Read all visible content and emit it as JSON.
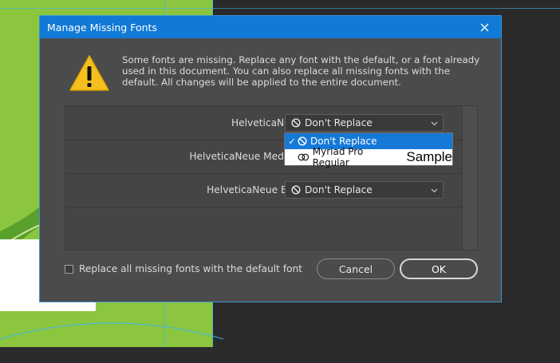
{
  "dialog": {
    "title": "Manage Missing Fonts",
    "message": "Some fonts are missing. Replace any font with the default, or a font already used in this document. You can also replace all missing fonts with the default. All changes will be applied to the entire document."
  },
  "font_rows": [
    {
      "name": "HelveticaNeue:",
      "replacement": "Don't Replace"
    },
    {
      "name": "HelveticaNeue Medium:",
      "replacement": ""
    },
    {
      "name": "HelveticaNeue Bold:",
      "replacement": "Don't Replace"
    }
  ],
  "dropdown": {
    "options": [
      {
        "label": "Don't Replace",
        "selected": true
      },
      {
        "label": "Myriad Pro Regular",
        "sample": "Sample",
        "selected": false
      }
    ]
  },
  "footer": {
    "replace_all_label": "Replace all missing fonts with the default font",
    "cancel_label": "Cancel",
    "ok_label": "OK"
  },
  "colors": {
    "titlebar": "#1179d6",
    "dialog_bg": "#4b4b4b",
    "selection": "#1779d7",
    "canvas_green": "#8cc63f"
  }
}
